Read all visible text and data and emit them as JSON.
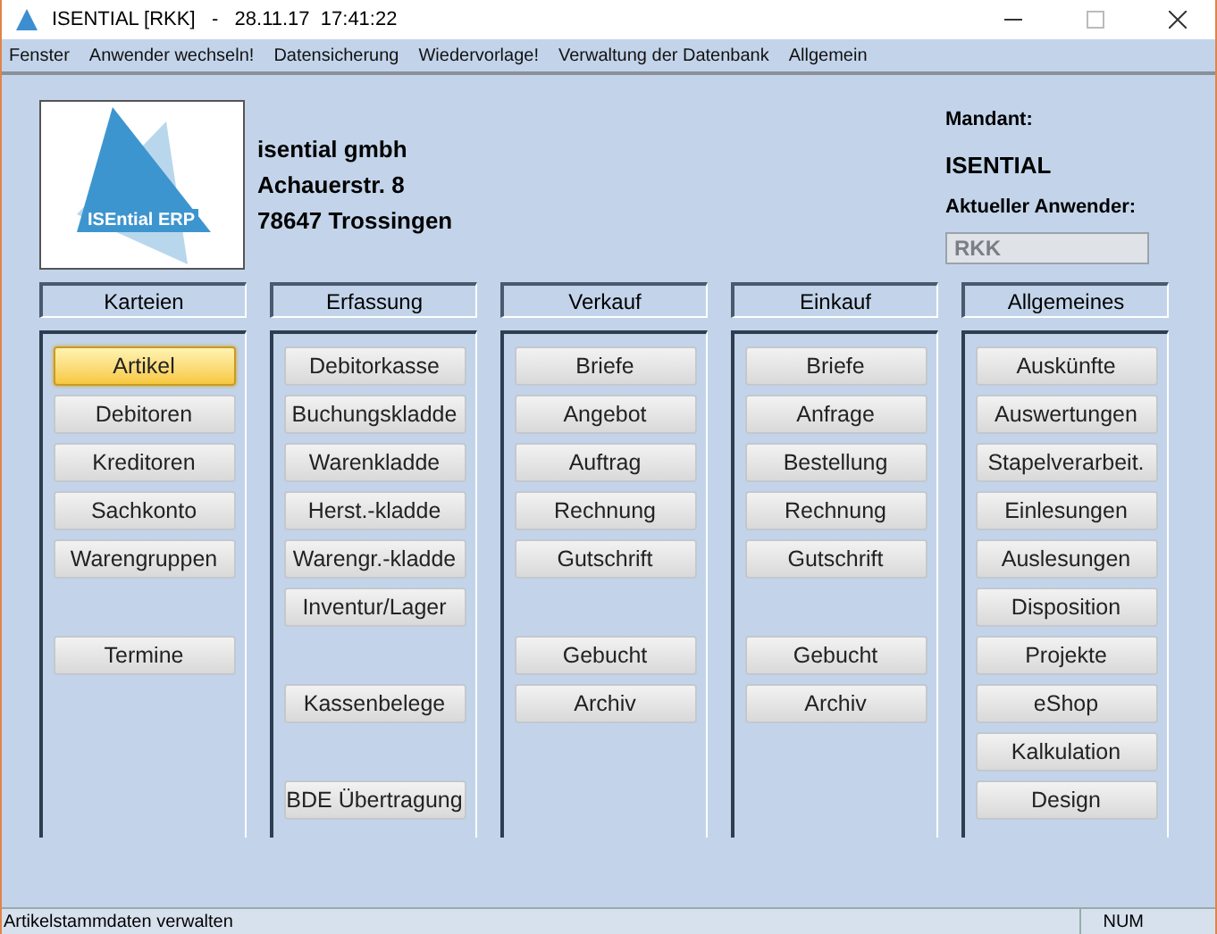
{
  "window": {
    "title": "ISENTIAL [RKK]   -   28.11.17  17:41:22"
  },
  "menu": [
    "Fenster",
    "Anwender wechseln!",
    "Datensicherung",
    "Wiedervorlage!",
    "Verwaltung der Datenbank",
    "Allgemein"
  ],
  "logo": {
    "text": "ISEntial ERP"
  },
  "company": [
    "isential gmbh",
    "Achauerstr. 8",
    "78647 Trossingen"
  ],
  "mandant": {
    "label": "Mandant:",
    "value": "ISENTIAL"
  },
  "user": {
    "label": "Aktueller Anwender:",
    "value": "RKK"
  },
  "columns": [
    {
      "title": "Karteien",
      "items": [
        {
          "kind": "button",
          "label": "Artikel",
          "selected": true
        },
        {
          "kind": "button",
          "label": "Debitoren",
          "selected": false
        },
        {
          "kind": "button",
          "label": "Kreditoren",
          "selected": false
        },
        {
          "kind": "button",
          "label": "Sachkonto",
          "selected": false
        },
        {
          "kind": "button",
          "label": "Warengruppen",
          "selected": false
        },
        {
          "kind": "spacer"
        },
        {
          "kind": "button",
          "label": "Termine",
          "selected": false
        }
      ]
    },
    {
      "title": "Erfassung",
      "items": [
        {
          "kind": "button",
          "label": "Debitorkasse",
          "selected": false
        },
        {
          "kind": "button",
          "label": "Buchungskladde",
          "selected": false
        },
        {
          "kind": "button",
          "label": "Warenkladde",
          "selected": false
        },
        {
          "kind": "button",
          "label": "Herst.-kladde",
          "selected": false
        },
        {
          "kind": "button",
          "label": "Warengr.-kladde",
          "selected": false
        },
        {
          "kind": "button",
          "label": "Inventur/Lager",
          "selected": false
        },
        {
          "kind": "spacer"
        },
        {
          "kind": "button",
          "label": "Kassenbelege",
          "selected": false
        },
        {
          "kind": "spacer"
        },
        {
          "kind": "button",
          "label": "BDE Übertragung",
          "selected": false
        }
      ]
    },
    {
      "title": "Verkauf",
      "items": [
        {
          "kind": "button",
          "label": "Briefe",
          "selected": false
        },
        {
          "kind": "button",
          "label": "Angebot",
          "selected": false
        },
        {
          "kind": "button",
          "label": "Auftrag",
          "selected": false
        },
        {
          "kind": "button",
          "label": "Rechnung",
          "selected": false
        },
        {
          "kind": "button",
          "label": "Gutschrift",
          "selected": false
        },
        {
          "kind": "spacer"
        },
        {
          "kind": "button",
          "label": "Gebucht",
          "selected": false
        },
        {
          "kind": "button",
          "label": "Archiv",
          "selected": false
        }
      ]
    },
    {
      "title": "Einkauf",
      "items": [
        {
          "kind": "button",
          "label": "Briefe",
          "selected": false
        },
        {
          "kind": "button",
          "label": "Anfrage",
          "selected": false
        },
        {
          "kind": "button",
          "label": "Bestellung",
          "selected": false
        },
        {
          "kind": "button",
          "label": "Rechnung",
          "selected": false
        },
        {
          "kind": "button",
          "label": "Gutschrift",
          "selected": false
        },
        {
          "kind": "spacer"
        },
        {
          "kind": "button",
          "label": "Gebucht",
          "selected": false
        },
        {
          "kind": "button",
          "label": "Archiv",
          "selected": false
        }
      ]
    },
    {
      "title": "Allgemeines",
      "items": [
        {
          "kind": "button",
          "label": "Auskünfte",
          "selected": false
        },
        {
          "kind": "button",
          "label": "Auswertungen",
          "selected": false
        },
        {
          "kind": "button",
          "label": "Stapelverarbeit.",
          "selected": false
        },
        {
          "kind": "button",
          "label": "Einlesungen",
          "selected": false
        },
        {
          "kind": "button",
          "label": "Auslesungen",
          "selected": false
        },
        {
          "kind": "button",
          "label": "Disposition",
          "selected": false
        },
        {
          "kind": "button",
          "label": "Projekte",
          "selected": false
        },
        {
          "kind": "button",
          "label": "eShop",
          "selected": false
        },
        {
          "kind": "button",
          "label": "Kalkulation",
          "selected": false
        },
        {
          "kind": "button",
          "label": "Design",
          "selected": false
        }
      ]
    }
  ],
  "status_bar": {
    "message": "Artikelstammdaten verwalten",
    "indicator": "NUM"
  }
}
